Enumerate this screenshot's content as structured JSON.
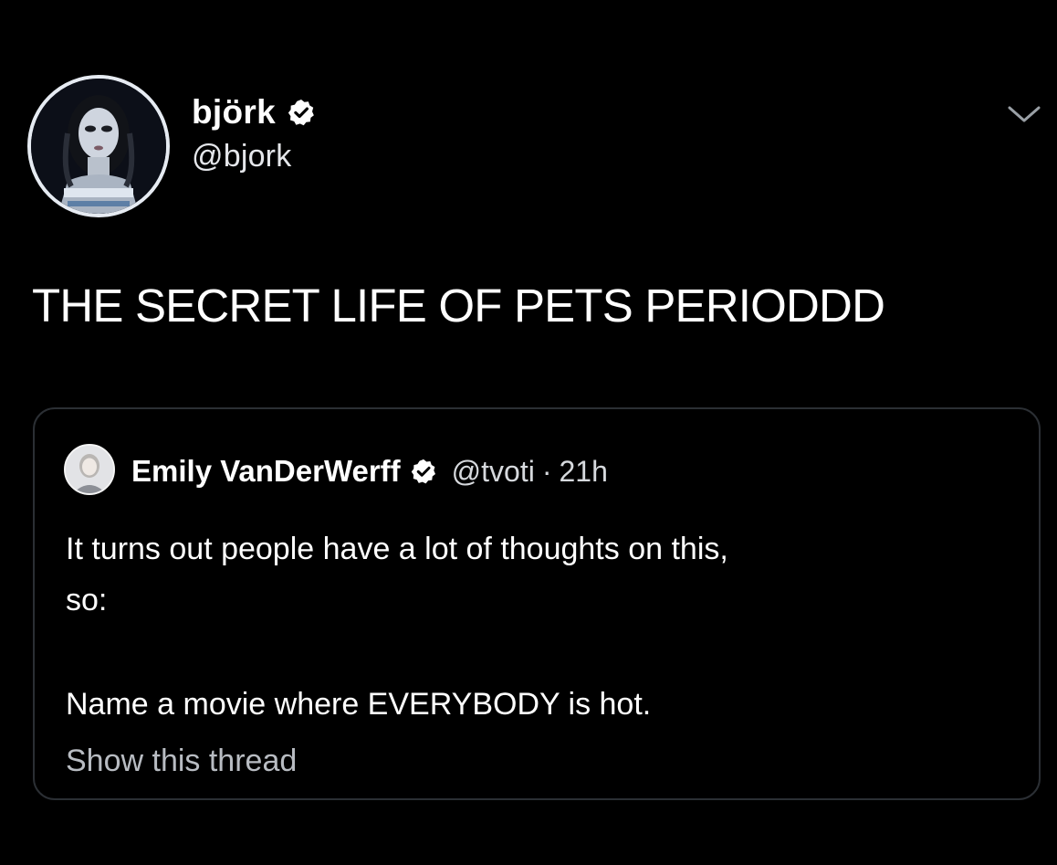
{
  "colors": {
    "background": "#000000",
    "text_primary": "#ffffff",
    "text_secondary": "#d6d9dd",
    "card_border": "#2b2f34",
    "verified_badge": "#ffffff"
  },
  "tweet": {
    "author": {
      "display_name": "björk",
      "handle": "@bjork",
      "verified": true
    },
    "text": "THE SECRET LIFE OF PETS PERIODDD",
    "menu_icon": "chevron-down-icon"
  },
  "quoted_tweet": {
    "author": {
      "display_name": "Emily VanDerWerff",
      "handle": "@tvoti",
      "verified": true
    },
    "separator": "·",
    "time": "21h",
    "text_line_1": "It turns out people have a lot of thoughts on this,",
    "text_line_2": "so:",
    "text_line_3": "Name a movie where EVERYBODY is hot.",
    "show_thread": "Show this thread"
  }
}
